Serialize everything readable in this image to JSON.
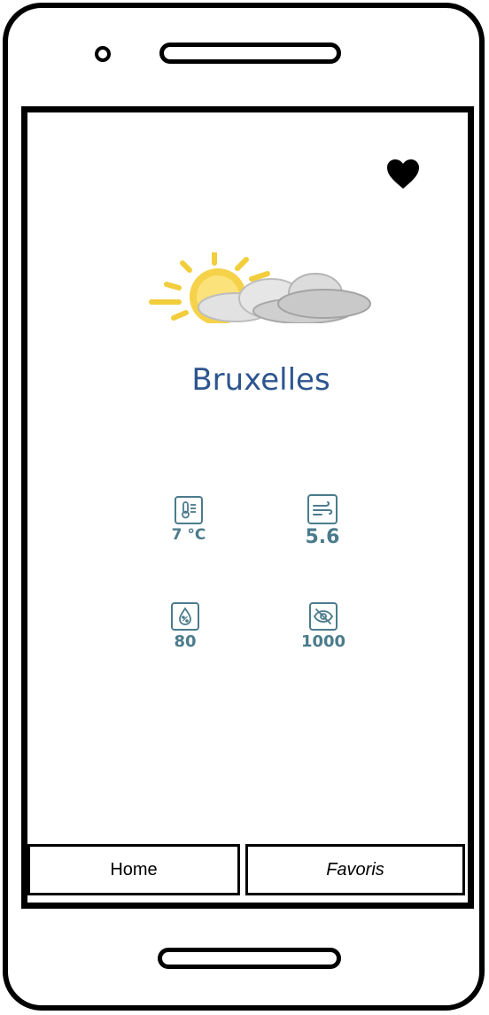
{
  "weather": {
    "city": "Bruxelles",
    "condition_icon": "partly-cloudy-icon",
    "temperature": "7 °C",
    "wind": "5.6",
    "humidity": "80",
    "visibility": "1000"
  },
  "icons": {
    "favorite": "heart-icon",
    "temperature": "thermometer-icon",
    "wind": "wind-icon",
    "humidity": "droplet-icon",
    "visibility": "eye-off-icon"
  },
  "nav": {
    "home_label": "Home",
    "favorites_label": "Favoris"
  },
  "colors": {
    "city": "#2d5590",
    "metric": "#4b7b8c"
  }
}
